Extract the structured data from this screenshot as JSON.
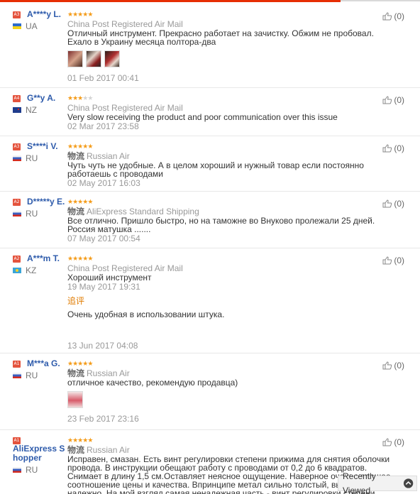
{
  "reviews": [
    {
      "buyer": "A****y L.",
      "level": "A3",
      "country": "UA",
      "rating": 5,
      "logistics_label": "",
      "shipping": "China Post Registered Air Mail",
      "text": "Отличный инструмент. Прекрасно работает на зачистку. Обжим не пробовал. Ехало в Украину месяца полтора-два",
      "photos": 3,
      "date": "01 Feb 2017 00:41",
      "helpful": "(0)"
    },
    {
      "buyer": "G**y A.",
      "level": "A4",
      "country": "NZ",
      "rating": 3,
      "logistics_label": "",
      "shipping": "China Post Registered Air Mail",
      "text": "Very slow receiving the product and poor communication over this issue",
      "date": "02 Mar 2017 23:58",
      "helpful": "(0)"
    },
    {
      "buyer": "S****i V.",
      "level": "A3",
      "country": "RU",
      "rating": 5,
      "logistics_label": "物流",
      "shipping": "Russian Air",
      "text": "Чуть чуть не удобные. А в целом хороший и нужный товар если постоянно работаешь с проводами",
      "date": "02 May 2017 16:03",
      "helpful": "(0)"
    },
    {
      "buyer": "D*****y E.",
      "level": "A2",
      "country": "RU",
      "rating": 5,
      "logistics_label": "物流",
      "shipping": "AliExpress Standard Shipping",
      "text": "Все отлично. Пришло быстро, но на таможне во Внуково пролежали 25 дней. Россия матушка .......",
      "date": "07 May 2017 00:54",
      "helpful": "(0)"
    },
    {
      "buyer": "A***m T.",
      "level": "A2",
      "country": "KZ",
      "rating": 5,
      "logistics_label": "",
      "shipping": "China Post Registered Air Mail",
      "text": "Хороший инструмент",
      "date": "19 May 2017 19:31",
      "followup_label": "追评",
      "followup_text": "Очень удобная в использовании штука.",
      "followup_date": "13 Jun 2017 04:08",
      "helpful": "(0)"
    },
    {
      "buyer": "M***a G.",
      "level": "A1",
      "country": "RU",
      "rating": 5,
      "logistics_label": "物流",
      "shipping": "Russian Air",
      "text": "отличное качество, рекомендую продавца)",
      "photos": 1,
      "date": "23 Feb 2017 23:16",
      "helpful": "(0)"
    },
    {
      "buyer": "AliExpress Shopper",
      "level": "A1",
      "country": "RU",
      "rating": 5,
      "logistics_label": "物流",
      "shipping": "Russian Air",
      "text": "Исправен, смазан. Есть винт регулировки степени прижима для снятия оболочки провода. В инструкции обещают работу с проводами от 0,2 до 6 квадратов. Снимает в длину 1,5 см.Оставляет неясное ощущение. Наверное очень хорошее соотношение цены и качества. Впринципе метал сильно толстый, выглядит надежно. На мой взгляд самая ненадежная часть - винт регулировки степени прижима.",
      "helpful": "(0)"
    }
  ],
  "recently_viewed": "Recently Viewed",
  "colors": {
    "accent": "#e62e04",
    "star": "#f49c1a",
    "name": "#2e5bab"
  },
  "icons": {
    "helpful": "thumbs-up-icon",
    "recent": "chevron-up-circle-icon"
  }
}
